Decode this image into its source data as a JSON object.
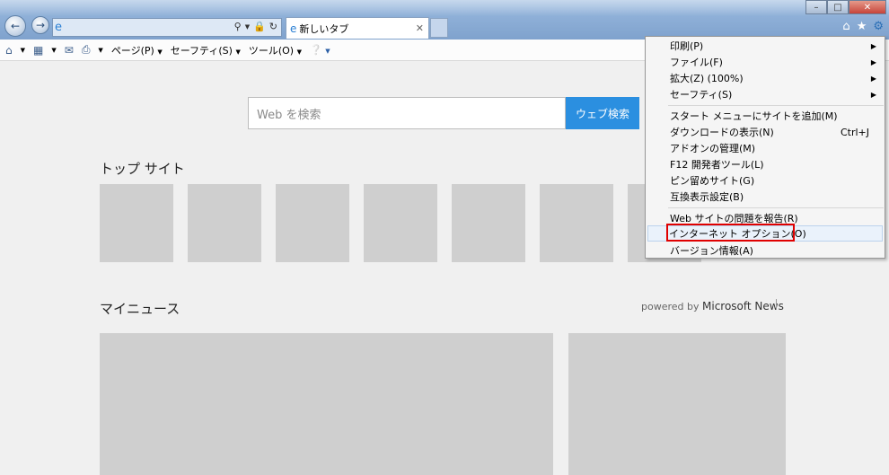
{
  "browser": {
    "tab_title": "新しいタブ",
    "address_value": ""
  },
  "command_bar": {
    "page": "ページ(P)",
    "safety": "セーフティ(S)",
    "tools": "ツール(O)"
  },
  "search": {
    "placeholder": "Web を検索",
    "button": "ウェブ検索"
  },
  "top_sites": {
    "heading": "トップ サイト"
  },
  "news": {
    "heading": "マイニュース",
    "powered_prefix": "powered by",
    "powered_brand": "Microsoft News"
  },
  "menu": {
    "items": [
      {
        "label": "印刷(P)",
        "shortcut": ""
      },
      {
        "label": "ファイル(F)",
        "shortcut": ""
      },
      {
        "label": "拡大(Z) (100%)",
        "shortcut": ""
      },
      {
        "label": "セーフティ(S)",
        "shortcut": ""
      },
      {
        "label": "スタート メニューにサイトを追加(M)",
        "shortcut": ""
      },
      {
        "label": "ダウンロードの表示(N)",
        "shortcut": "Ctrl+J"
      },
      {
        "label": "アドオンの管理(M)",
        "shortcut": ""
      },
      {
        "label": "F12 開発者ツール(L)",
        "shortcut": ""
      },
      {
        "label": "ピン留めサイト(G)",
        "shortcut": ""
      },
      {
        "label": "互換表示設定(B)",
        "shortcut": ""
      },
      {
        "label": "Web サイトの問題を報告(R)",
        "shortcut": ""
      },
      {
        "label": "インターネット オプション(O)",
        "shortcut": ""
      },
      {
        "label": "バージョン情報(A)",
        "shortcut": ""
      }
    ]
  },
  "colors": {
    "accent_button": "#2b8fe0",
    "highlight_outline": "#e00000"
  }
}
